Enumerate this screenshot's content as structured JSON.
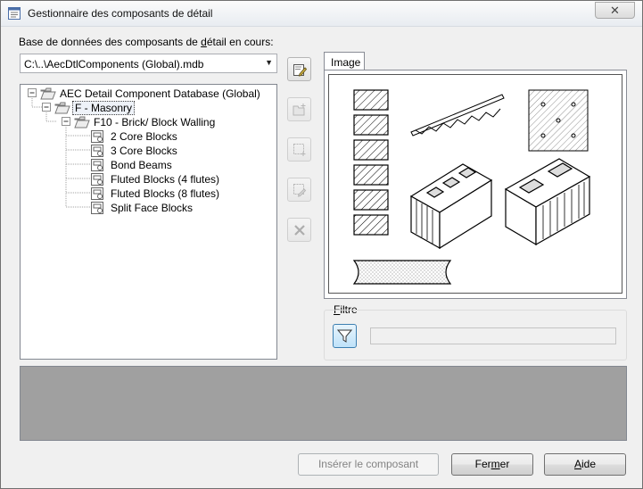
{
  "window": {
    "title": "Gestionnaire des composants de détail",
    "close_label": "✕"
  },
  "database": {
    "label_pre": "Base de données des composants de ",
    "label_ul": "d",
    "label_post": "étail en cours:",
    "value": "C:\\..\\AecDtlComponents (Global).mdb"
  },
  "tree": {
    "root": "AEC Detail Component Database (Global)",
    "level1": "F - Masonry",
    "level2": "F10 - Brick/ Block Walling",
    "items": [
      "2 Core Blocks",
      "3 Core Blocks",
      "Bond Beams",
      "Fluted Blocks (4 flutes)",
      "Fluted Blocks (8 flutes)",
      "Split Face Blocks"
    ]
  },
  "side_buttons": [
    "edit-database-icon",
    "new-folder-icon",
    "add-component-icon",
    "edit-component-icon",
    "delete-icon"
  ],
  "image_tab": {
    "label": "Image"
  },
  "filter": {
    "label_ul": "F",
    "label_rest": "iltre",
    "value": ""
  },
  "buttons": {
    "insert": "Insérer le composant",
    "close_pre": "Fer",
    "close_ul": "m",
    "close_post": "er",
    "help_ul": "A",
    "help_post": "ide"
  }
}
